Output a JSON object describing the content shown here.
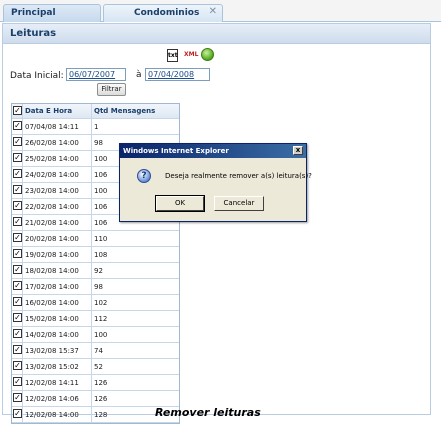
{
  "tabs": [
    {
      "label": "Principal"
    },
    {
      "label": "Condominios",
      "close": "✕"
    }
  ],
  "panel": {
    "title": "Leituras"
  },
  "icons": {
    "txt": "txt",
    "xml": "XML",
    "go": "go-icon"
  },
  "filter": {
    "label": "Data Inicial:",
    "start_value": "06/07/2007",
    "separator": "à",
    "end_value": "07/04/2008",
    "button": "Filtrar"
  },
  "grid": {
    "headers": [
      "Data E Hora",
      "Qtd Mensagens"
    ],
    "rows": [
      {
        "date": "07/04/08 14:11",
        "qtd": "1"
      },
      {
        "date": "26/02/08 14:00",
        "qtd": "98"
      },
      {
        "date": "25/02/08 14:00",
        "qtd": "100"
      },
      {
        "date": "24/02/08 14:00",
        "qtd": "106"
      },
      {
        "date": "23/02/08 14:00",
        "qtd": "100"
      },
      {
        "date": "22/02/08 14:00",
        "qtd": "106"
      },
      {
        "date": "21/02/08 14:00",
        "qtd": "106"
      },
      {
        "date": "20/02/08 14:00",
        "qtd": "110"
      },
      {
        "date": "19/02/08 14:00",
        "qtd": "108"
      },
      {
        "date": "18/02/08 14:00",
        "qtd": "92"
      },
      {
        "date": "17/02/08 14:00",
        "qtd": "98"
      },
      {
        "date": "16/02/08 14:00",
        "qtd": "102"
      },
      {
        "date": "15/02/08 14:00",
        "qtd": "112"
      },
      {
        "date": "14/02/08 14:00",
        "qtd": "100"
      },
      {
        "date": "13/02/08 15:37",
        "qtd": "74"
      },
      {
        "date": "13/02/08 15:02",
        "qtd": "52"
      },
      {
        "date": "12/02/08 14:11",
        "qtd": "126"
      },
      {
        "date": "12/02/08 14:06",
        "qtd": "126"
      },
      {
        "date": "12/02/08 14:00",
        "qtd": "128"
      }
    ]
  },
  "dialog": {
    "title": "Windows Internet Explorer",
    "close": "x",
    "icon": "?",
    "message": "Deseja realmente remover a(s) leitura(s)?",
    "ok": "OK",
    "cancel": "Cancelar"
  },
  "caption": "Remover leituras"
}
